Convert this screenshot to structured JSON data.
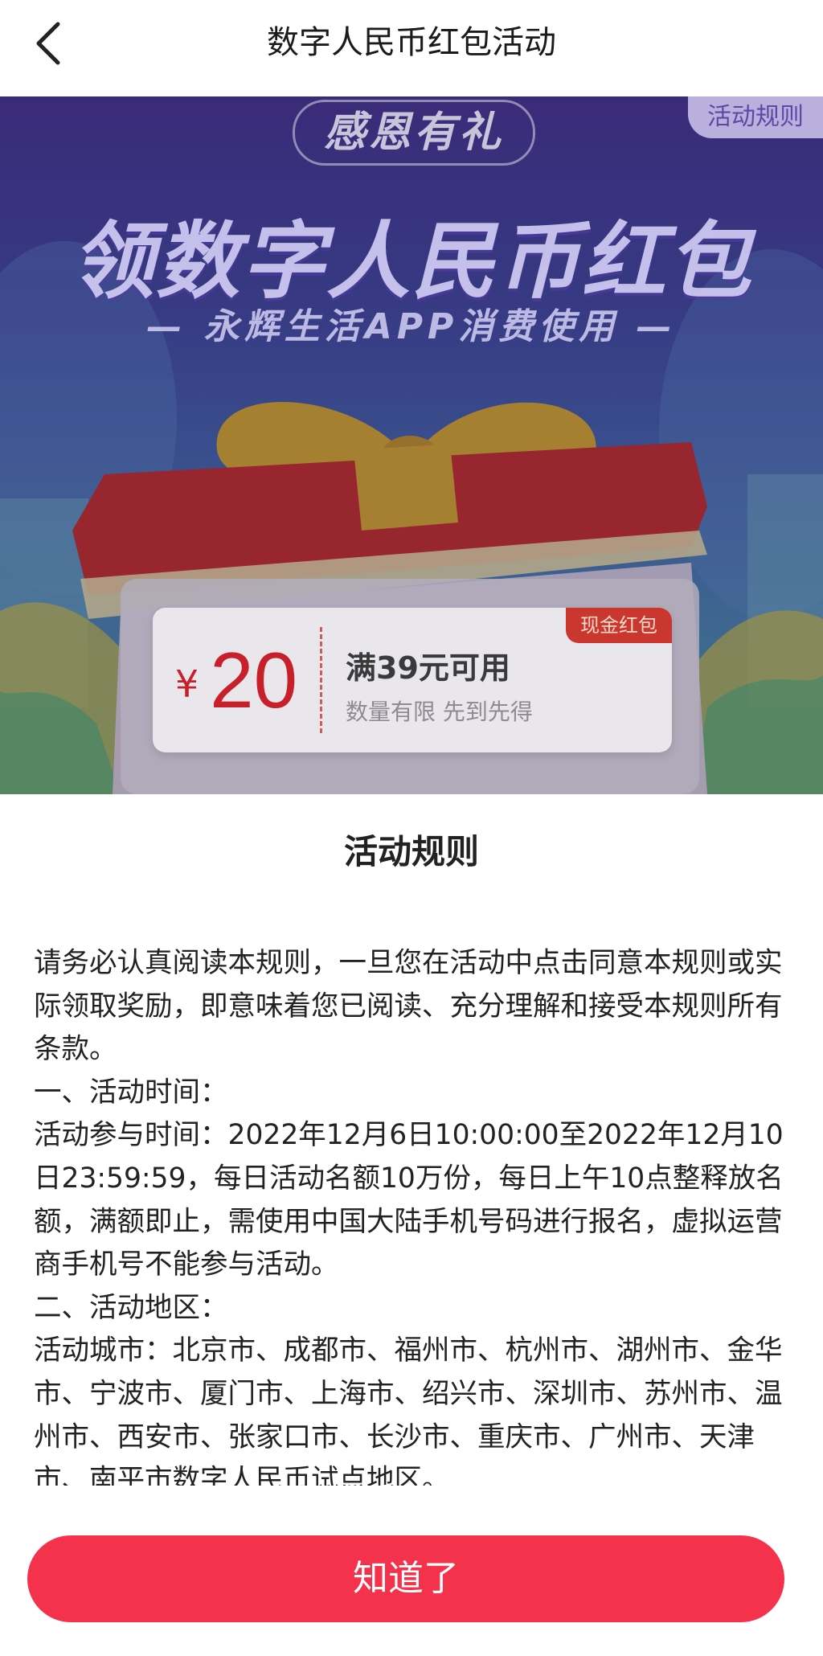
{
  "header": {
    "title": "数字人民币红包活动",
    "back_icon": "chevron-left-icon"
  },
  "banner": {
    "rules_tab": "活动规则",
    "pill_text": "感恩有礼",
    "headline": "领数字人民币红包",
    "subline": "— 永辉生活APP消费使用 —",
    "coupon": {
      "currency": "¥",
      "amount": "20",
      "condition": "满39元可用",
      "note": "数量有限 先到先得",
      "tag": "现金红包"
    },
    "colors": {
      "accent": "#c8202a",
      "ribbon": "#d8a23a"
    }
  },
  "rules_sheet": {
    "title": "活动规则",
    "paragraphs": [
      "请务必认真阅读本规则，一旦您在活动中点击同意本规则或实际领取奖励，即意味着您已阅读、充分理解和接受本规则所有条款。",
      "一、活动时间：",
      "活动参与时间：2022年12月6日10:00:00至2022年12月10日23:59:59，每日活动名额10万份，每日上午10点整释放名额，满额即止，需使用中国大陆手机号码进行报名，虚拟运营商手机号不能参与活动。",
      "二、活动地区：",
      "活动城市：北京市、成都市、福州市、杭州市、湖州市、金华市、宁波市、厦门市、上海市、绍兴市、深圳市、苏州市、温州市、西安市、张家口市、长沙市、重庆市、广州市、天津市、南平市数字人民币试点地区。"
    ],
    "confirm_button": "知道了",
    "button_color": "#f5324b"
  }
}
